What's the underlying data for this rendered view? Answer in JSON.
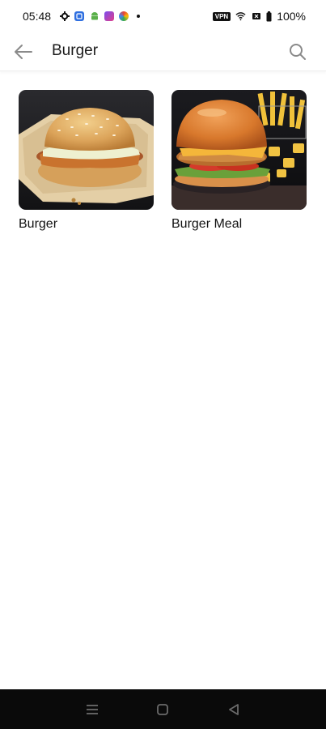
{
  "status_bar": {
    "time": "05:48",
    "vpn": "VPN",
    "battery": "100%",
    "icons": [
      "settings-icon",
      "app-icon-blue",
      "android-icon",
      "app-icon-pink",
      "app-icon-colorful",
      "notification-dot",
      "vpn-icon",
      "wifi-icon",
      "sim-icon",
      "battery-icon"
    ]
  },
  "app_bar": {
    "title": "Burger",
    "back_icon": "arrow-left-icon",
    "search_icon": "search-icon"
  },
  "items": [
    {
      "label": "Burger"
    },
    {
      "label": "Burger Meal"
    }
  ],
  "nav_bar": {
    "icons": [
      "menu-icon",
      "home-icon",
      "back-triangle-icon"
    ]
  },
  "colors": {
    "background": "#ffffff",
    "text": "#111111",
    "nav_bar": "#0a0a0a",
    "divider": "#eeeeee"
  }
}
